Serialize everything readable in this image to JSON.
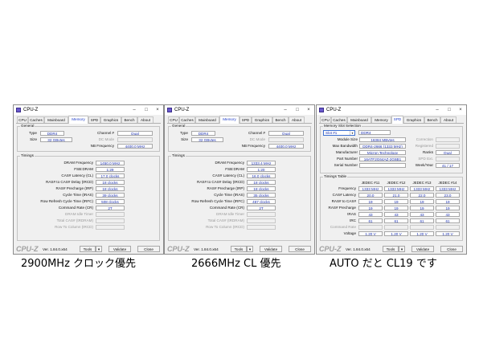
{
  "app_title": "CPU-Z",
  "window_controls": {
    "minimize": "–",
    "maximize": "□",
    "close": "×"
  },
  "tabs": [
    "CPU",
    "Caches",
    "Mainboard",
    "Memory",
    "SPD",
    "Graphics",
    "Bench",
    "About"
  ],
  "bottom": {
    "brand": "CPU-Z",
    "version": "Ver. 1.84.0.x64",
    "tools": "Tools",
    "validate": "Validate",
    "close": "Close"
  },
  "labels": {
    "general": "General",
    "type": "Type",
    "size": "Size",
    "channel": "Channel #",
    "dc_mode": "DC Mode",
    "nb_freq": "NB Frequency",
    "timings": "Timings",
    "dram_freq": "DRAM Frequency",
    "fsb_dram": "FSB:DRAM",
    "cas": "CAS# Latency (CL)",
    "rcd": "RAS# to CAS# Delay (tRCD)",
    "rp": "RAS# Precharge (tRP)",
    "ras": "Cycle Time (tRAS)",
    "rfc": "Row Refresh Cycle Time (tRFC)",
    "cr": "Command Rate (CR)",
    "idle": "DRAM Idle Timer",
    "rdram": "Total CAS# (tRDRAM)",
    "rtc": "Row To Column (tRCD)"
  },
  "windows": [
    {
      "type": "DDR4",
      "size": "32 GBytes",
      "channel": "Dual",
      "nb_freq": "4400.0 MHz",
      "dram_freq": "1450.0 MHz",
      "fsb_dram": "1:29",
      "cas": "17.0 clocks",
      "rcd": "18 clocks",
      "rp": "18 clocks",
      "ras": "39 clocks",
      "rfc": "508 clocks",
      "cr": "2T"
    },
    {
      "type": "DDR4",
      "size": "32 GBytes",
      "channel": "Dual",
      "nb_freq": "4400.0 MHz",
      "dram_freq": "1333.4 MHz",
      "fsb_dram": "1:20",
      "cas": "16.0 clocks",
      "rcd": "18 clocks",
      "rp": "18 clocks",
      "ras": "35 clocks",
      "rfc": "467 clocks",
      "cr": "2T"
    }
  ],
  "spd": {
    "group_title": "Memory Slot Selection",
    "slot": "Slot #1",
    "slot_type": "DDR4",
    "labels": {
      "module_size": "Module Size",
      "max_bw": "Max Bandwidth",
      "manufacturer": "Manufacturer",
      "part": "Part Number",
      "serial": "Serial Number",
      "correction": "Correction",
      "registered": "Registered",
      "ranks": "Ranks",
      "spd_ext": "SPD Ext.",
      "week_year": "Week/Year"
    },
    "module_size": "16384 MBytes",
    "max_bw": "DDR4-2666 (1333 MHz)",
    "manufacturer": "Micron Technology",
    "part": "16ATF2G64AZ-2G6B1",
    "serial": "",
    "ranks": "Dual",
    "week_year": "41 / 17",
    "table_title": "Timings Table",
    "columns": [
      "JEDEC #11",
      "JEDEC #12",
      "JEDEC #13",
      "JEDEC #14"
    ],
    "rows": [
      {
        "label": "Frequency",
        "values": [
          "1333 MHz",
          "1333 MHz",
          "1333 MHz",
          "1333 MHz"
        ]
      },
      {
        "label": "CAS# Latency",
        "values": [
          "20.0",
          "21.0",
          "22.0",
          "23.0"
        ]
      },
      {
        "label": "RAS# to CAS#",
        "values": [
          "19",
          "19",
          "19",
          "19"
        ]
      },
      {
        "label": "RAS# Precharge",
        "values": [
          "19",
          "19",
          "19",
          "19"
        ]
      },
      {
        "label": "tRAS",
        "values": [
          "43",
          "43",
          "43",
          "43"
        ]
      },
      {
        "label": "tRC",
        "values": [
          "61",
          "61",
          "61",
          "61"
        ]
      },
      {
        "label": "Command Rate",
        "values": [
          "",
          "",
          "",
          ""
        ]
      },
      {
        "label": "Voltage",
        "values": [
          "1.20 V",
          "1.20 V",
          "1.20 V",
          "1.20 V"
        ]
      }
    ]
  },
  "captions": [
    "2900MHz クロック優先",
    "2666MHz CL 優先",
    "AUTO だと CL19 です"
  ],
  "colors": {
    "value_text": "#1a2fb0",
    "active_tab": "#1e3cc8",
    "window_bg": "#f0f0f0"
  }
}
